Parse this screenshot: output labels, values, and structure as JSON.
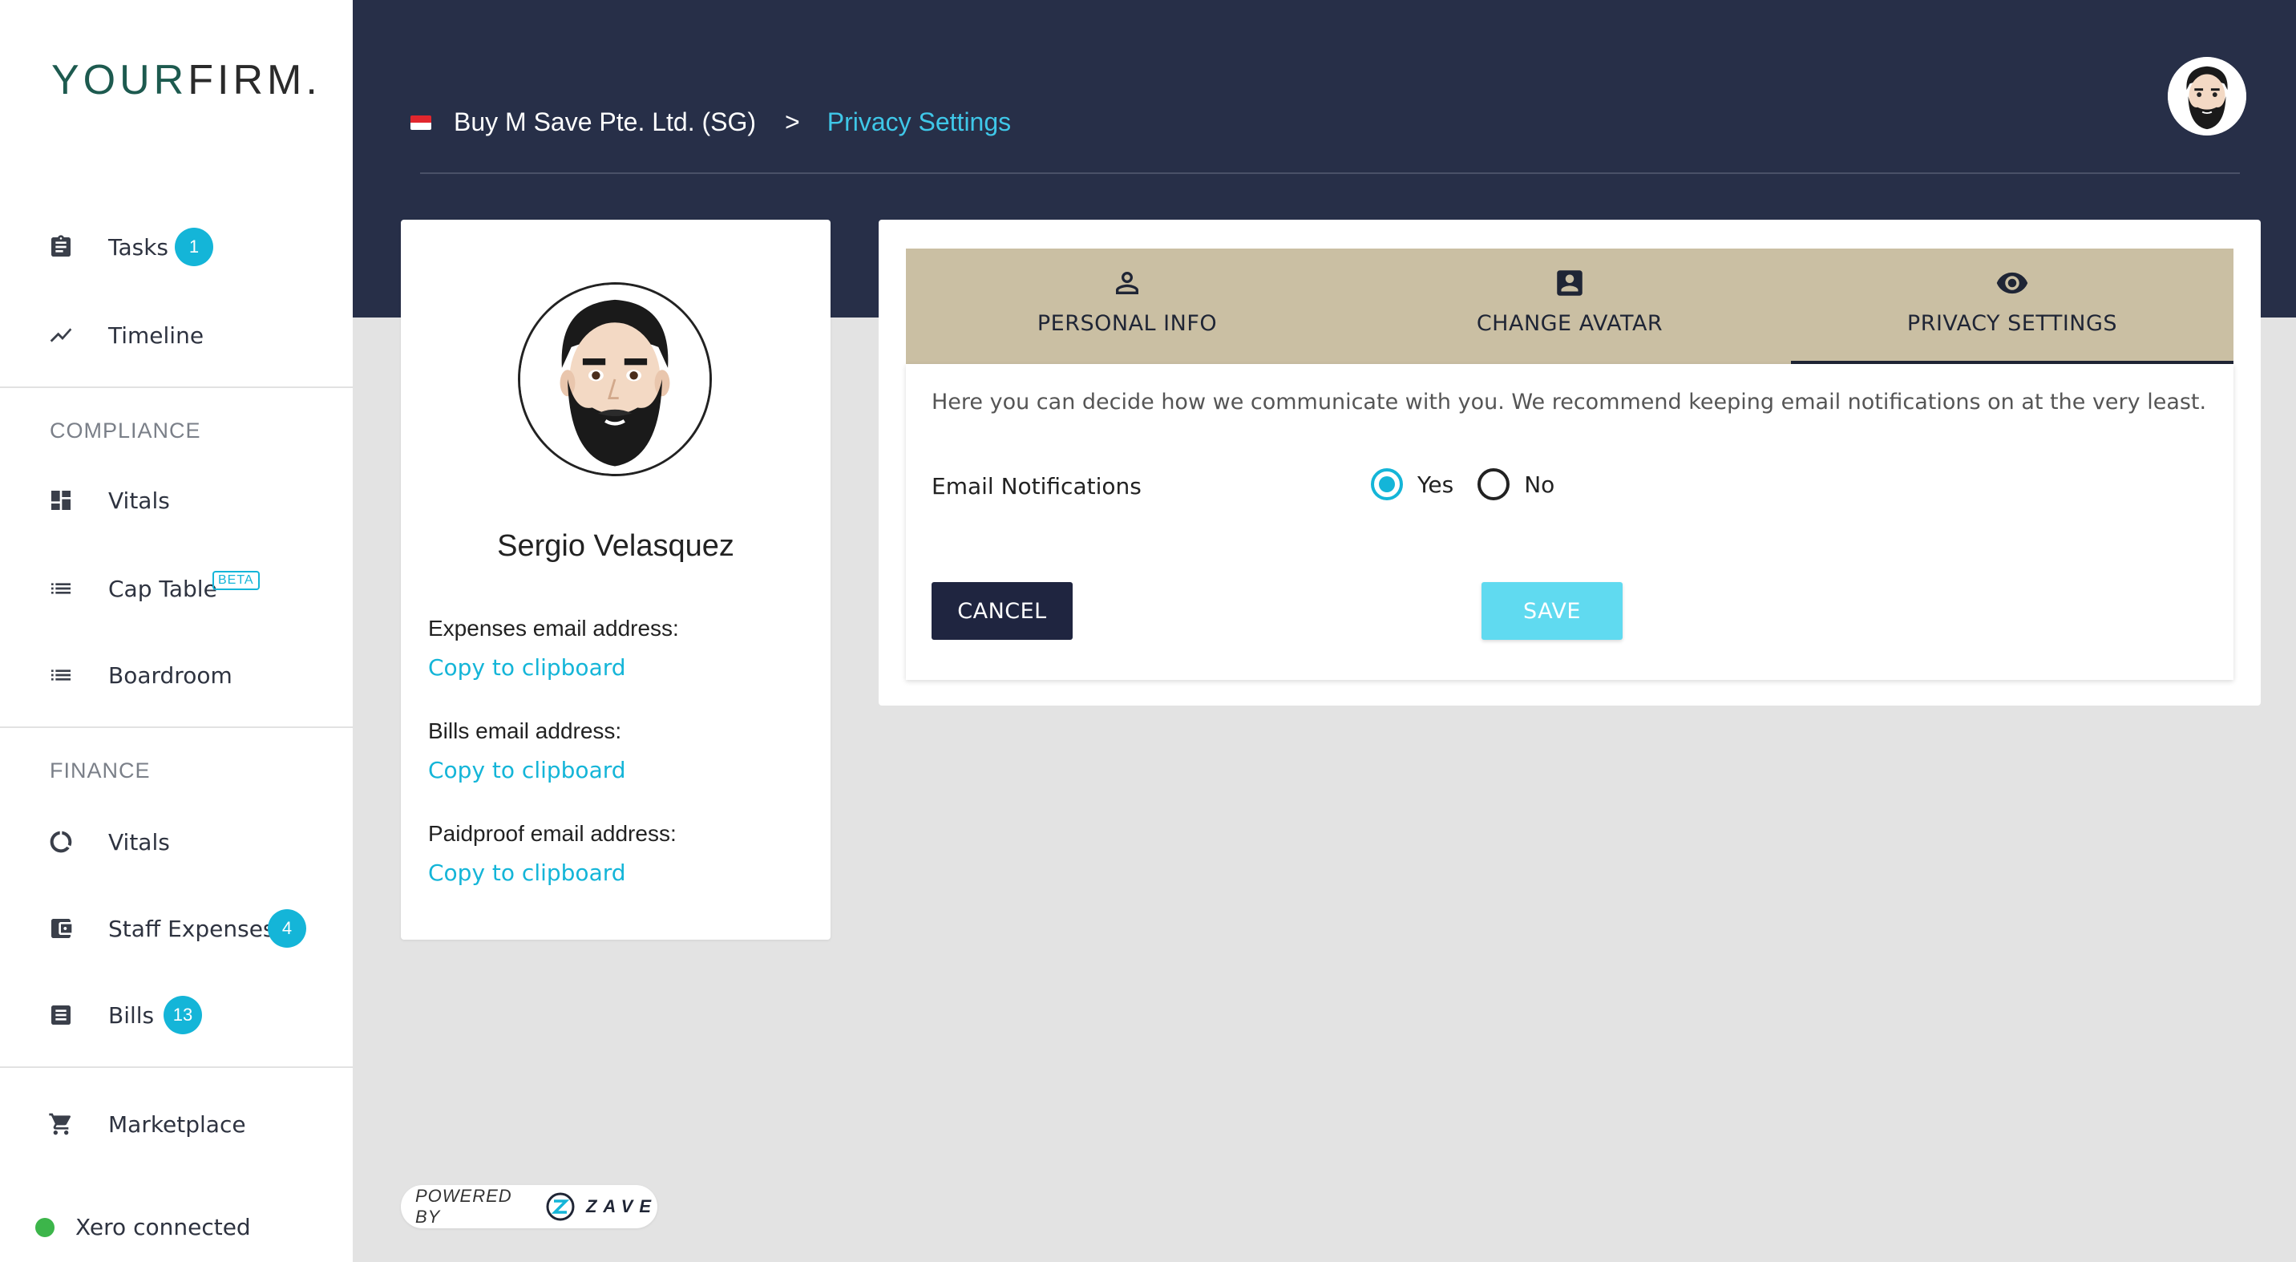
{
  "sidebar": {
    "logo_your": "YOUR",
    "logo_firm": "FIRM.",
    "tasks": {
      "label": "Tasks",
      "badge": "1"
    },
    "timeline": {
      "label": "Timeline"
    },
    "compliance_title": "COMPLIANCE",
    "compliance_vitals": {
      "label": "Vitals"
    },
    "cap_table": {
      "label": "Cap Table",
      "tag": "BETA"
    },
    "boardroom": {
      "label": "Boardroom"
    },
    "finance_title": "FINANCE",
    "finance_vitals": {
      "label": "Vitals"
    },
    "staff_expenses": {
      "label": "Staff Expenses",
      "badge": "4"
    },
    "bills": {
      "label": "Bills",
      "badge": "13"
    },
    "marketplace": {
      "label": "Marketplace"
    },
    "xero_status": "Xero connected"
  },
  "header": {
    "company": "Buy M Save Pte. Ltd. (SG)",
    "separator": ">",
    "current": "Privacy Settings"
  },
  "profile": {
    "name": "Sergio Velasquez",
    "expenses_label": "Expenses email address:",
    "bills_label": "Bills email address:",
    "paidproof_label": "Paidproof email address:",
    "copy_text": "Copy to clipboard"
  },
  "tabs": [
    {
      "label": "PERSONAL INFO",
      "icon": "person-icon"
    },
    {
      "label": "CHANGE AVATAR",
      "icon": "account-box-icon"
    },
    {
      "label": "PRIVACY SETTINGS",
      "icon": "eye-icon"
    }
  ],
  "privacy": {
    "intro": "Here you can decide how we communicate with you. We recommend keeping email notifications on at the very least.",
    "email_notifications_label": "Email Notifications",
    "yes_label": "Yes",
    "no_label": "No",
    "selected": "Yes",
    "cancel_label": "CANCEL",
    "save_label": "SAVE"
  },
  "footer": {
    "powered_by": "POWERED BY",
    "brand": "ZAVE"
  },
  "colors": {
    "accent": "#14b5d8",
    "header_bg": "#272f48",
    "tab_bg": "#cabfa3",
    "xero_green": "#3cb54a"
  }
}
